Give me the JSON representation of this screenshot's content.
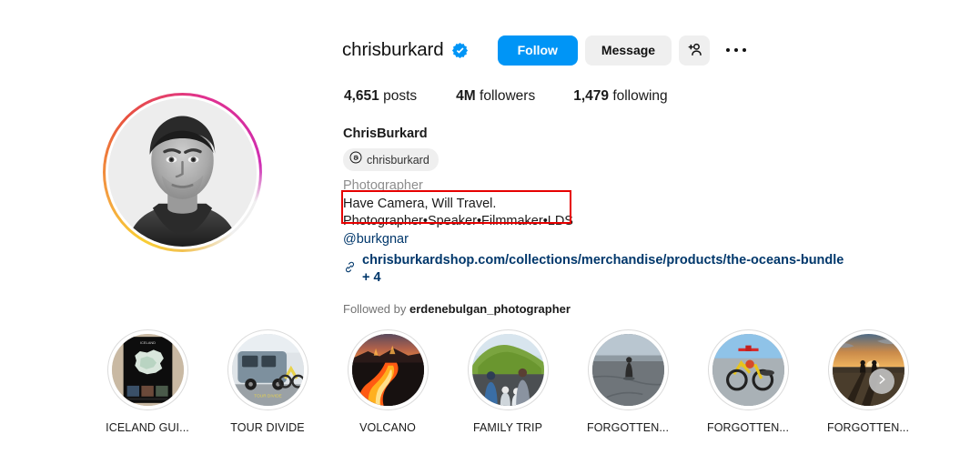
{
  "profile": {
    "username": "chrisburkard",
    "verified": true,
    "verified_icon": "verified-badge-icon",
    "full_name": "ChrisBurkard",
    "threads_handle": "chrisburkard",
    "threads_icon": "threads-icon",
    "category": "Photographer",
    "bio": "Have Camera, Will Travel.\nPhotographer•Speaker•Filmmaker•LDS",
    "bio_mention": "@burkgnar",
    "link_icon": "link-chain-icon",
    "link_text": "chrisburkardshop.com/collections/merchandise/products/the-oceans-bundle + 4",
    "followed_by_prefix": "Followed by",
    "followed_by_user": "erdenebulgan_photographer"
  },
  "actions": {
    "follow_label": "Follow",
    "message_label": "Message",
    "add_person_icon": "add-person-icon",
    "options_icon": "more-options-icon"
  },
  "stats": [
    {
      "value": "4,651",
      "label": "posts"
    },
    {
      "value": "4M",
      "label": "followers"
    },
    {
      "value": "1,479",
      "label": "following"
    }
  ],
  "highlights": [
    {
      "label": "ICELAND GUI...",
      "art": "iceland-map-poster"
    },
    {
      "label": "TOUR DIVIDE",
      "art": "van-and-bike"
    },
    {
      "label": "VOLCANO",
      "art": "lava-flow"
    },
    {
      "label": "FAMILY TRIP",
      "art": "family-green-mountain"
    },
    {
      "label": "FORGOTTEN...",
      "art": "cyclist-on-flats"
    },
    {
      "label": "FORGOTTEN...",
      "art": "yellow-bike-plane"
    },
    {
      "label": "FORGOTTEN...",
      "art": "sunset-riders"
    }
  ],
  "carousel": {
    "next_icon": "chevron-right-icon"
  },
  "colors": {
    "follow_blue": "#0095f6",
    "verified_blue": "#0095f6",
    "link_navy": "#00376b",
    "muted_gray": "#8e8e8e",
    "chip_gray": "#efefef",
    "annotation_red": "#e60000"
  }
}
